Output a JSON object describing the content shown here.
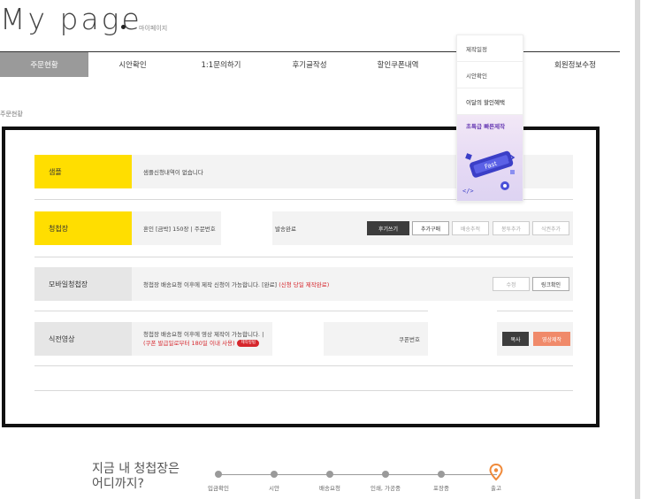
{
  "header": {
    "title": "My page",
    "subtitle": "마이페이지"
  },
  "nav": {
    "tabs": [
      {
        "label": "주문현황",
        "active": true
      },
      {
        "label": "시안확인"
      },
      {
        "label": "1:1문의하기"
      },
      {
        "label": "후기글작성"
      },
      {
        "label": "할인쿠폰내역"
      },
      {
        "label": ""
      },
      {
        "label": "회원정보수정"
      }
    ]
  },
  "breadcrumb": "주문현황",
  "rows": {
    "sample": {
      "label": "샘플",
      "text": "샘플신청내역이 없습니다"
    },
    "invitation": {
      "label": "청첩장",
      "text": "혼인 [금박] 150장 | 주문번호",
      "status": "발송완료",
      "buttons": [
        "후기쓰기",
        "추가구매",
        "배송추적",
        "봉투추가",
        "식권추가"
      ]
    },
    "mobile": {
      "label": "모바일청첩장",
      "text": "청첩장 배송요청 이후에 제작 신청이 가능합니다. [완료]",
      "status": "(신청 당일 제작완료)",
      "buttons": [
        "수정",
        "링크확인"
      ]
    },
    "video": {
      "label": "식전영상",
      "text": "청첩장 배송요청 이후에 영상 제작이 가능합니다. |",
      "note": "(쿠폰 발급일로부터 180일 이내 사용)",
      "pill": "제작방법",
      "coupon_label": "쿠폰번호",
      "buttons": [
        "복사",
        "영상제작"
      ]
    }
  },
  "float_menu": {
    "items": [
      "제작일정",
      "시안확인",
      "이달의 할인혜택"
    ],
    "banner_text": "초특급 빠른제작",
    "banner_badge": "Fast"
  },
  "progress": {
    "title": "지금 내 청첩장은 어디까지?",
    "steps": [
      "입금확인",
      "시안",
      "배송요청",
      "인쇄, 가공중",
      "포장중",
      "출고"
    ],
    "current_step": "출고"
  },
  "colors": {
    "yellow": "#ffde00",
    "red": "#d6262c",
    "orange": "#f08a6a",
    "accent": "#f08a3a"
  }
}
